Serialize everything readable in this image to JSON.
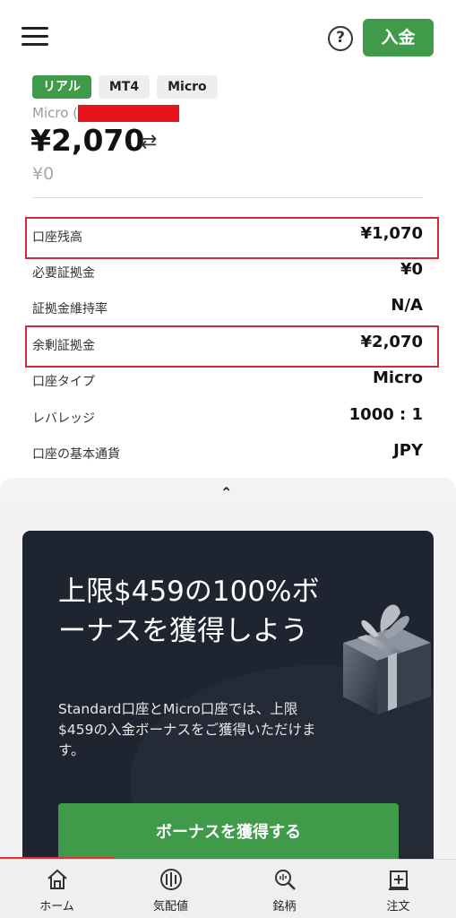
{
  "header": {
    "menu_icon": "hamburger-menu-icon",
    "help_icon": "question-circle-icon",
    "help_glyph": "?",
    "deposit_label": "入金",
    "deposit_color": "#3f9b4a"
  },
  "account": {
    "tags": [
      "リアル",
      "MT4",
      "Micro"
    ],
    "name_prefix": "Micro (",
    "balance": "¥2,070",
    "swap_glyph": "⇄",
    "sub_balance": "¥0"
  },
  "details": [
    {
      "label": "口座残高",
      "value": "¥1,070"
    },
    {
      "label": "必要証拠金",
      "value": "¥0"
    },
    {
      "label": "証拠金維持率",
      "value": "N/A"
    },
    {
      "label": "余剰証拠金",
      "value": "¥2,070"
    },
    {
      "label": "口座タイプ",
      "value": "Micro"
    },
    {
      "label": "レバレッジ",
      "value": "1000 : 1"
    },
    {
      "label": "口座の基本通貨",
      "value": "JPY"
    }
  ],
  "collapse_glyph": "⌃",
  "promo": {
    "title": "上限$459の100%ボーナスを獲得しよう",
    "description": "Standard口座とMicro口座では、上限$459の入金ボーナスをご獲得いただけます。",
    "button_label": "ボーナスを獲得する",
    "gift_icon": "gift-box-icon"
  },
  "bottom_nav": [
    {
      "label": "ホーム",
      "icon": "home-icon"
    },
    {
      "label": "気配値",
      "icon": "quotes-icon"
    },
    {
      "label": "銘柄",
      "icon": "search-chart-icon"
    },
    {
      "label": "注文",
      "icon": "order-icon"
    }
  ],
  "colors": {
    "accent_green": "#3f9b4a",
    "highlight_red": "#d42a35",
    "promo_bg": "#1e2430"
  }
}
